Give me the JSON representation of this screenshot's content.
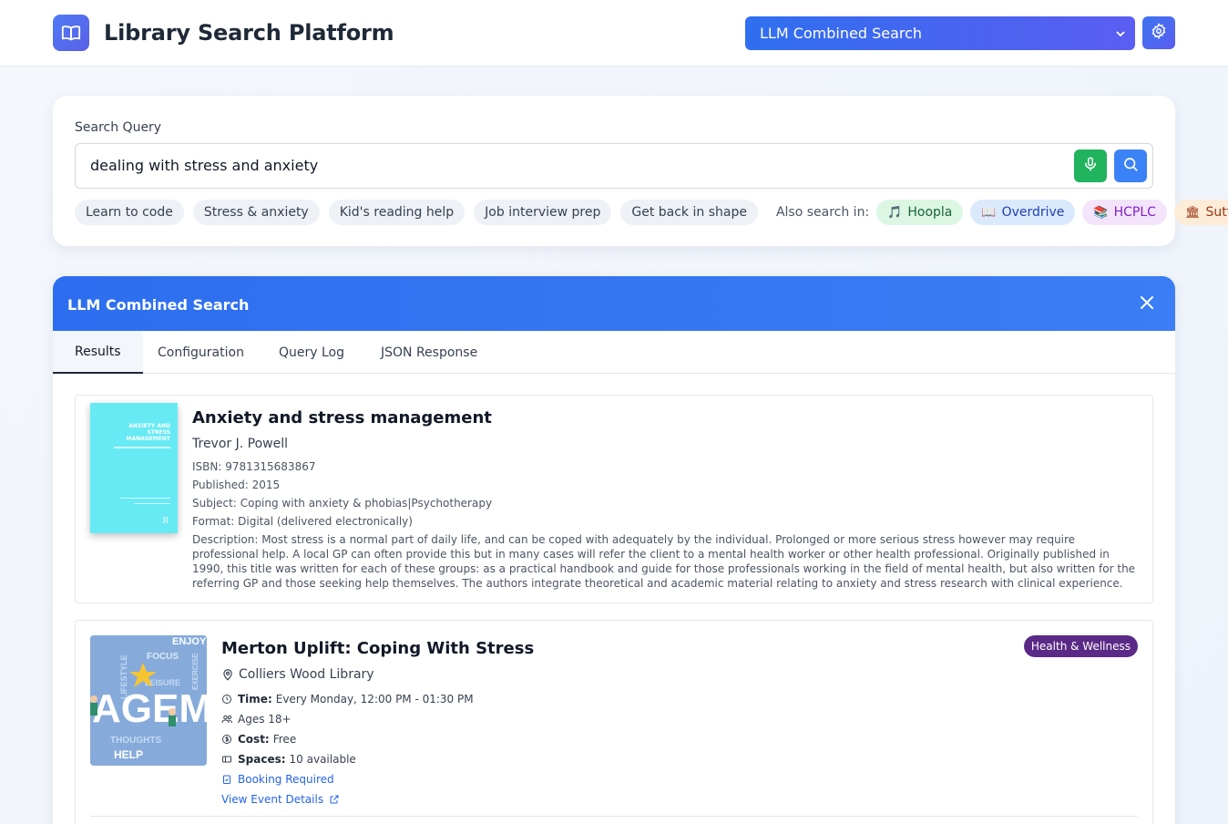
{
  "header": {
    "title": "Library Search Platform",
    "mode_select": "LLM Combined Search"
  },
  "search": {
    "label": "Search Query",
    "value": "dealing with stress and anxiety",
    "suggestions": [
      "Learn to code",
      "Stress & anxiety",
      "Kid's reading help",
      "Job interview prep",
      "Get back in shape"
    ],
    "also_label": "Also search in:",
    "sources": [
      {
        "label": "Hoopla",
        "icon": "music-note-icon"
      },
      {
        "label": "Overdrive",
        "icon": "book-icon"
      },
      {
        "label": "HCPLC",
        "icon": "books-icon"
      },
      {
        "label": "Sutton",
        "icon": "library-icon"
      }
    ]
  },
  "panel": {
    "title": "LLM Combined Search",
    "tabs": [
      "Results",
      "Configuration",
      "Query Log",
      "JSON Response"
    ],
    "active_tab": "Results"
  },
  "results": [
    {
      "title": "Anxiety and stress management",
      "author": "Trevor J. Powell",
      "isbn": "ISBN: 9781315683867",
      "published": "Published: 2015",
      "subject": "Subject: Coping with anxiety & phobias|Psychotherapy",
      "format": "Format: Digital (delivered electronically)",
      "description": "Description: Most stress is a normal part of daily life, and can be coped with adequately by the individual. Prolonged or more serious stress however may require professional help. A local GP can often provide this but in many cases will refer the client to a mental health worker or other health professional. Originally published in 1990, this title was written for each of these groups: as a practical handbook and guide for those professionals working in the field of mental health, but also written for the referring GP and those seeking help themselves. The authors integrate theoretical and academic material relating to anxiety and stress research with clinical experience.",
      "cover_title": "ANXIETY AND STRESS MANAGEMENT"
    },
    {
      "title": "Merton Uplift: Coping With Stress",
      "location": "Colliers Wood Library",
      "badge": "Health & Wellness",
      "time_label": "Time:",
      "time": "Every Monday, 12:00 PM - 01:30 PM",
      "ages": "Ages 18+",
      "cost_label": "Cost:",
      "cost": "Free",
      "spaces_label": "Spaces:",
      "spaces": "10 available",
      "booking": "Booking Required",
      "details_link": "View Event Details",
      "image_words": [
        "ENJOY",
        "FOCUS",
        "AGEM",
        "HELP",
        "THOUGHTS",
        "LIFESTYLE",
        "LEISURE",
        "EXERCISE"
      ]
    }
  ],
  "colors": {
    "accent": "#3b82f6",
    "header_gradient_end": "#5b5ef2",
    "mic": "#22b35e",
    "badge": "#5b2a86"
  }
}
